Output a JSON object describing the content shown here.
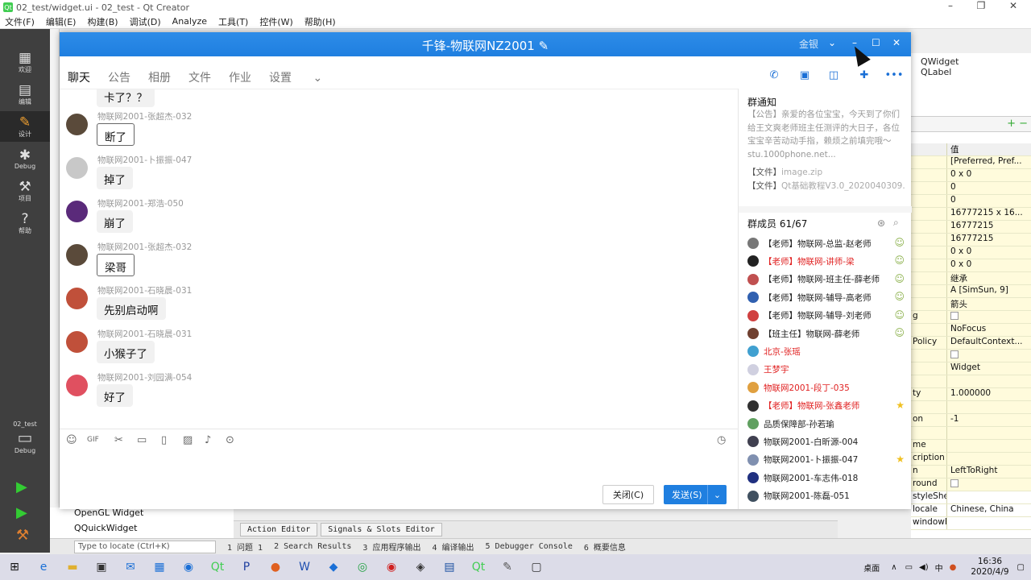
{
  "qt_window": {
    "title": "02_test/widget.ui - 02_test - Qt Creator",
    "logo": "Qt"
  },
  "menu": [
    "文件(F)",
    "编辑(E)",
    "构建(B)",
    "调试(D)",
    "Analyze",
    "工具(T)",
    "控件(W)",
    "帮助(H)"
  ],
  "modes": [
    {
      "label": "欢迎",
      "icon": "grid-icon"
    },
    {
      "label": "编辑",
      "icon": "document-icon"
    },
    {
      "label": "设计",
      "icon": "pencil-icon"
    },
    {
      "label": "Debug",
      "icon": "bug-icon"
    },
    {
      "label": "项目",
      "icon": "wrench-icon"
    },
    {
      "label": "帮助",
      "icon": "help-icon"
    }
  ],
  "project": {
    "name": "02_test",
    "mode": "Debug"
  },
  "widget_box": [
    "OpenGL Widget",
    "QQuickWidget"
  ],
  "editor_tabs": [
    "Action Editor",
    "Signals & Slots Editor"
  ],
  "output": {
    "locate_placeholder": "Type to locate (Ctrl+K)",
    "panes": [
      "1 问题 1",
      "2 Search Results",
      "3 应用程序输出",
      "4 编译输出",
      "5 Debugger Console",
      "6 概要信息"
    ]
  },
  "object_tree": [
    "QWidget",
    "QLabel"
  ],
  "properties": {
    "header_value": "值",
    "rows": [
      {
        "k": "",
        "v": "[Preferred, Pref..."
      },
      {
        "k": "",
        "v": "0 x 0"
      },
      {
        "k": "",
        "v": "0"
      },
      {
        "k": "",
        "v": "0"
      },
      {
        "k": "",
        "v": "16777215 x 16..."
      },
      {
        "k": "",
        "v": "16777215"
      },
      {
        "k": "",
        "v": "16777215"
      },
      {
        "k": "",
        "v": "0 x 0"
      },
      {
        "k": "",
        "v": "0 x 0"
      },
      {
        "k": "",
        "v": "继承"
      },
      {
        "k": "",
        "v": "A  [SimSun, 9]"
      },
      {
        "k": "",
        "v": "箭头"
      },
      {
        "k": "g",
        "v": ""
      },
      {
        "k": "",
        "v": "NoFocus"
      },
      {
        "k": "Policy",
        "v": "DefaultContext..."
      },
      {
        "k": "",
        "v": ""
      },
      {
        "k": "",
        "v": "Widget"
      },
      {
        "k": "",
        "v": ""
      },
      {
        "k": "ty",
        "v": "1.000000"
      },
      {
        "k": "",
        "v": ""
      },
      {
        "k": "on",
        "v": "-1"
      },
      {
        "k": "",
        "v": ""
      },
      {
        "k": "me",
        "v": ""
      },
      {
        "k": "cription",
        "v": ""
      },
      {
        "k": "n",
        "v": "LeftToRight"
      },
      {
        "k": "round",
        "v": ""
      },
      {
        "k": "styleSheet",
        "v": ""
      },
      {
        "k": "locale",
        "v": "Chinese, China"
      },
      {
        "k": "windowFilePath",
        "v": ""
      }
    ]
  },
  "chat": {
    "title": "千锋-物联网NZ2001",
    "top_controls": "金银",
    "tabs": [
      "聊天",
      "公告",
      "相册",
      "文件",
      "作业",
      "设置"
    ],
    "partial_top": "卡了？？",
    "messages": [
      {
        "sender": "物联网2001-张超杰-032",
        "text": "断了",
        "style": "hand",
        "color": "#5a4a3a"
      },
      {
        "sender": "物联网2001-卜振振-047",
        "text": "掉了",
        "style": "plain",
        "color": "#c8c8c8"
      },
      {
        "sender": "物联网2001-郑浩-050",
        "text": "崩了",
        "style": "plain",
        "color": "#5a2a7a"
      },
      {
        "sender": "物联网2001-张超杰-032",
        "text": "梁哥",
        "style": "hand",
        "color": "#5a4a3a"
      },
      {
        "sender": "物联网2001-石晓晨-031",
        "text": "先别启动啊",
        "style": "plain",
        "color": "#c0503a"
      },
      {
        "sender": "物联网2001-石晓晨-031",
        "text": "小猴子了",
        "style": "plain",
        "color": "#c0503a"
      },
      {
        "sender": "物联网2001-刘园满-054",
        "text": "好了",
        "style": "plain",
        "color": "#e05060"
      }
    ],
    "close_label": "关闭(C)",
    "send_label": "发送(S)",
    "notice_title": "群通知",
    "notice_text": "【公告】亲爱的各位宝宝，今天到了你们给王文爽老师班主任测评的大日子，各位宝宝辛苦动动手指，赖烦之前填完哦～stu.1000phone.net...",
    "files": [
      {
        "tag": "【文件】",
        "name": "image.zip"
      },
      {
        "tag": "【文件】",
        "name": "Qt基础教程V3.0_2020040309..."
      }
    ],
    "members_title": "群成员 61/67",
    "members": [
      {
        "name": "【老师】物联网-总监-赵老师",
        "red": false,
        "badge": "person",
        "color": "#777"
      },
      {
        "name": "【老师】物联网-讲师-梁",
        "red": true,
        "badge": "person",
        "color": "#222"
      },
      {
        "name": "【老师】物联网-班主任-薛老师",
        "red": false,
        "badge": "person",
        "color": "#c05050"
      },
      {
        "name": "【老师】物联网-辅导-高老师",
        "red": false,
        "badge": "person",
        "color": "#3060b0"
      },
      {
        "name": "【老师】物联网-辅导-刘老师",
        "red": false,
        "badge": "person",
        "color": "#d04040"
      },
      {
        "name": "【班主任】物联网-薛老师",
        "red": false,
        "badge": "person",
        "color": "#704030"
      },
      {
        "name": "北京-张瑶",
        "red": true,
        "badge": "",
        "color": "#40a0d0"
      },
      {
        "name": "王梦宇",
        "red": true,
        "badge": "",
        "color": "#d0d0e0"
      },
      {
        "name": "物联网2001-段丁-035",
        "red": true,
        "badge": "",
        "color": "#e0a040"
      },
      {
        "name": "【老师】物联网-张鑫老师",
        "red": true,
        "badge": "star",
        "color": "#303030"
      },
      {
        "name": "品质保障部-孙若瑜",
        "red": false,
        "badge": "",
        "color": "#60a060"
      },
      {
        "name": "物联网2001-白昕源-004",
        "red": false,
        "badge": "",
        "color": "#404050"
      },
      {
        "name": "物联网2001-卜振振-047",
        "red": false,
        "badge": "star",
        "color": "#8090b0"
      },
      {
        "name": "物联网2001-车志伟-018",
        "red": false,
        "badge": "",
        "color": "#203080"
      },
      {
        "name": "物联网2001-陈磊-051",
        "red": false,
        "badge": "",
        "color": "#405060"
      }
    ]
  },
  "taskbar": {
    "clock_time": "16:36",
    "clock_date": "2020/4/9",
    "desktop": "桌面",
    "ime": "中"
  }
}
